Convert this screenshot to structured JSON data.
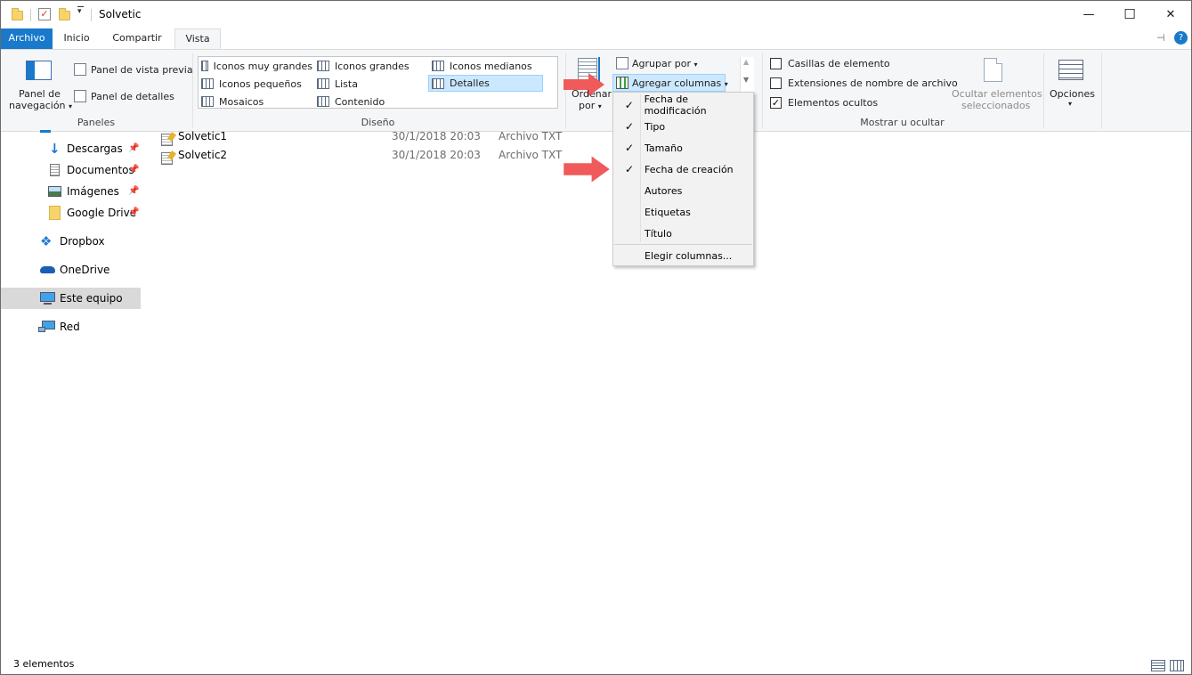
{
  "window": {
    "title": "Solvetic",
    "minimize_label": "—",
    "maximize_label": "☐",
    "close_label": "✕"
  },
  "tabs": {
    "file": "Archivo",
    "home": "Inicio",
    "share": "Compartir",
    "view": "Vista"
  },
  "ribbon": {
    "panes": {
      "label": "Paneles",
      "nav_pane_line1": "Panel de",
      "nav_pane_line2": "navegación",
      "preview_pane": "Panel de vista previa",
      "details_pane": "Panel de detalles"
    },
    "layout": {
      "label": "Diseño",
      "items": [
        "Iconos muy grandes",
        "Iconos grandes",
        "Iconos medianos",
        "Iconos pequeños",
        "Lista",
        "Detalles",
        "Mosaicos",
        "Contenido"
      ]
    },
    "current_view": {
      "sort_line1": "Ordenar",
      "sort_line2": "por",
      "group_by": "Agrupar por",
      "add_columns": "Agregar columnas"
    },
    "show_hide": {
      "label": "Mostrar u ocultar",
      "item_checkboxes": "Casillas de elemento",
      "file_extensions": "Extensiones de nombre de archivo",
      "hidden_items": "Elementos ocultos",
      "hide_selected_line1": "Ocultar elementos",
      "hide_selected_line2": "seleccionados",
      "hidden_items_checked": true
    },
    "options": "Opciones"
  },
  "nav": {
    "items": [
      {
        "label": "Descargas"
      },
      {
        "label": "Documentos"
      },
      {
        "label": "Imágenes"
      },
      {
        "label": "Google Drive"
      },
      {
        "label": "Dropbox"
      },
      {
        "label": "OneDrive"
      },
      {
        "label": "Este equipo"
      },
      {
        "label": "Red"
      }
    ]
  },
  "files": [
    {
      "name": "Solvetic1",
      "date": "30/1/2018 20:03",
      "type": "Archivo TXT"
    },
    {
      "name": "Solvetic2",
      "date": "30/1/2018 20:03",
      "type": "Archivo TXT"
    }
  ],
  "menu": {
    "items": [
      {
        "label": "Fecha de modificación",
        "check": "✓"
      },
      {
        "label": "Tipo",
        "check": "✓"
      },
      {
        "label": "Tamaño",
        "check": "✓"
      },
      {
        "label": "Fecha de creación",
        "check": "✓"
      },
      {
        "label": "Autores",
        "check": ""
      },
      {
        "label": "Etiquetas",
        "check": ""
      },
      {
        "label": "Título",
        "check": ""
      }
    ],
    "choose_columns": "Elegir columnas..."
  },
  "status": {
    "count": "3 elementos"
  },
  "colors": {
    "accent": "#1979ca",
    "arrow": "#f05a5a"
  }
}
